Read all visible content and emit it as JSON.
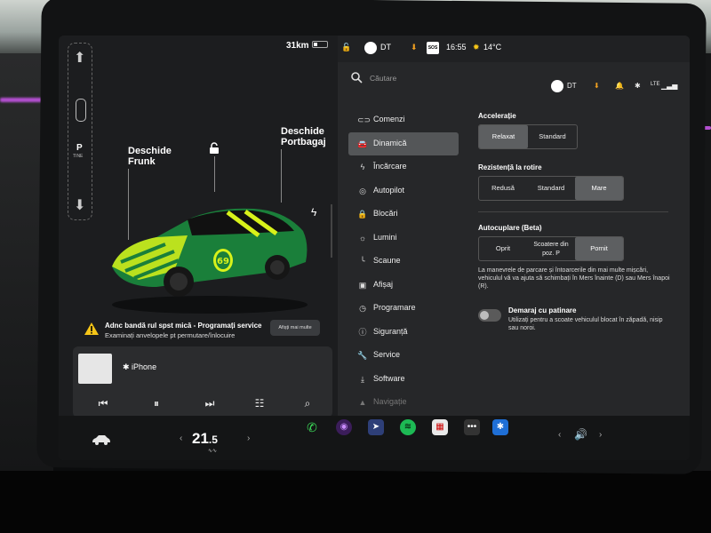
{
  "colors": {
    "accent_purple": "#b34fd0",
    "car_green": "#1a7f3a",
    "car_yellow": "#d8f21a",
    "selected_bg": "#5d5f61",
    "spotify": "#1db954"
  },
  "left_panel": {
    "range": "31km",
    "gear": {
      "letter": "P",
      "sub": "TINE"
    },
    "frunk_label": "Deschide\nFrunk",
    "trunk_label": "Deschide\nPortbagaj",
    "car_number": "69",
    "alert": {
      "title": "Adnc bandă rul spst mică - Programați service",
      "subtitle": "Examinați anvelopele pt permutare/înlocuire",
      "button": "Afișți mai multe"
    },
    "media": {
      "source": "iPhone"
    }
  },
  "taskbar": {
    "temp_whole": "21",
    "temp_decimal": ".5",
    "left_arrow": "‹",
    "right_arrow": "›"
  },
  "status_bar": {
    "profile": "DT",
    "time": "16:55",
    "outside_temp": "14°C",
    "sos": "SOS"
  },
  "search": {
    "placeholder": "Căutare"
  },
  "header": {
    "profile": "DT",
    "network": "LTE"
  },
  "nav": [
    {
      "label": "Comenzi",
      "icon": "toggle-icon"
    },
    {
      "label": "Dinamică",
      "icon": "car-icon"
    },
    {
      "label": "Încărcare",
      "icon": "bolt-icon"
    },
    {
      "label": "Autopilot",
      "icon": "steering-wheel-icon"
    },
    {
      "label": "Blocări",
      "icon": "lock-icon"
    },
    {
      "label": "Lumini",
      "icon": "sun-icon"
    },
    {
      "label": "Scaune",
      "icon": "seat-icon"
    },
    {
      "label": "Afișaj",
      "icon": "display-icon"
    },
    {
      "label": "Programare",
      "icon": "clock-icon"
    },
    {
      "label": "Siguranță",
      "icon": "shield-icon"
    },
    {
      "label": "Service",
      "icon": "wrench-icon"
    },
    {
      "label": "Software",
      "icon": "download-icon"
    },
    {
      "label": "Navigație",
      "icon": "navigation-icon"
    }
  ],
  "dinamica": {
    "acceleration": {
      "title": "Accelerație",
      "options": [
        "Relaxat",
        "Standard"
      ],
      "selected": 0
    },
    "rolling": {
      "title": "Rezistență la rotire",
      "options": [
        "Redusă",
        "Standard",
        "Mare"
      ],
      "selected": 2
    },
    "autohold": {
      "title": "Autocuplare (Beta)",
      "options": [
        "Oprit",
        "Scoatere din\npoz. P",
        "Pornit"
      ],
      "selected": 2,
      "description": "La manevrele de parcare și întoarcerile din mai multe mișcări, vehiculul vă va ajuta să schimbați în Mers înainte (D) sau Mers înapoi (R)."
    },
    "slip_start": {
      "title": "Demaraj cu patinare",
      "description": "Utilizați pentru a scoate vehiculul blocat în zăpadă, nisip sau noroi."
    }
  }
}
